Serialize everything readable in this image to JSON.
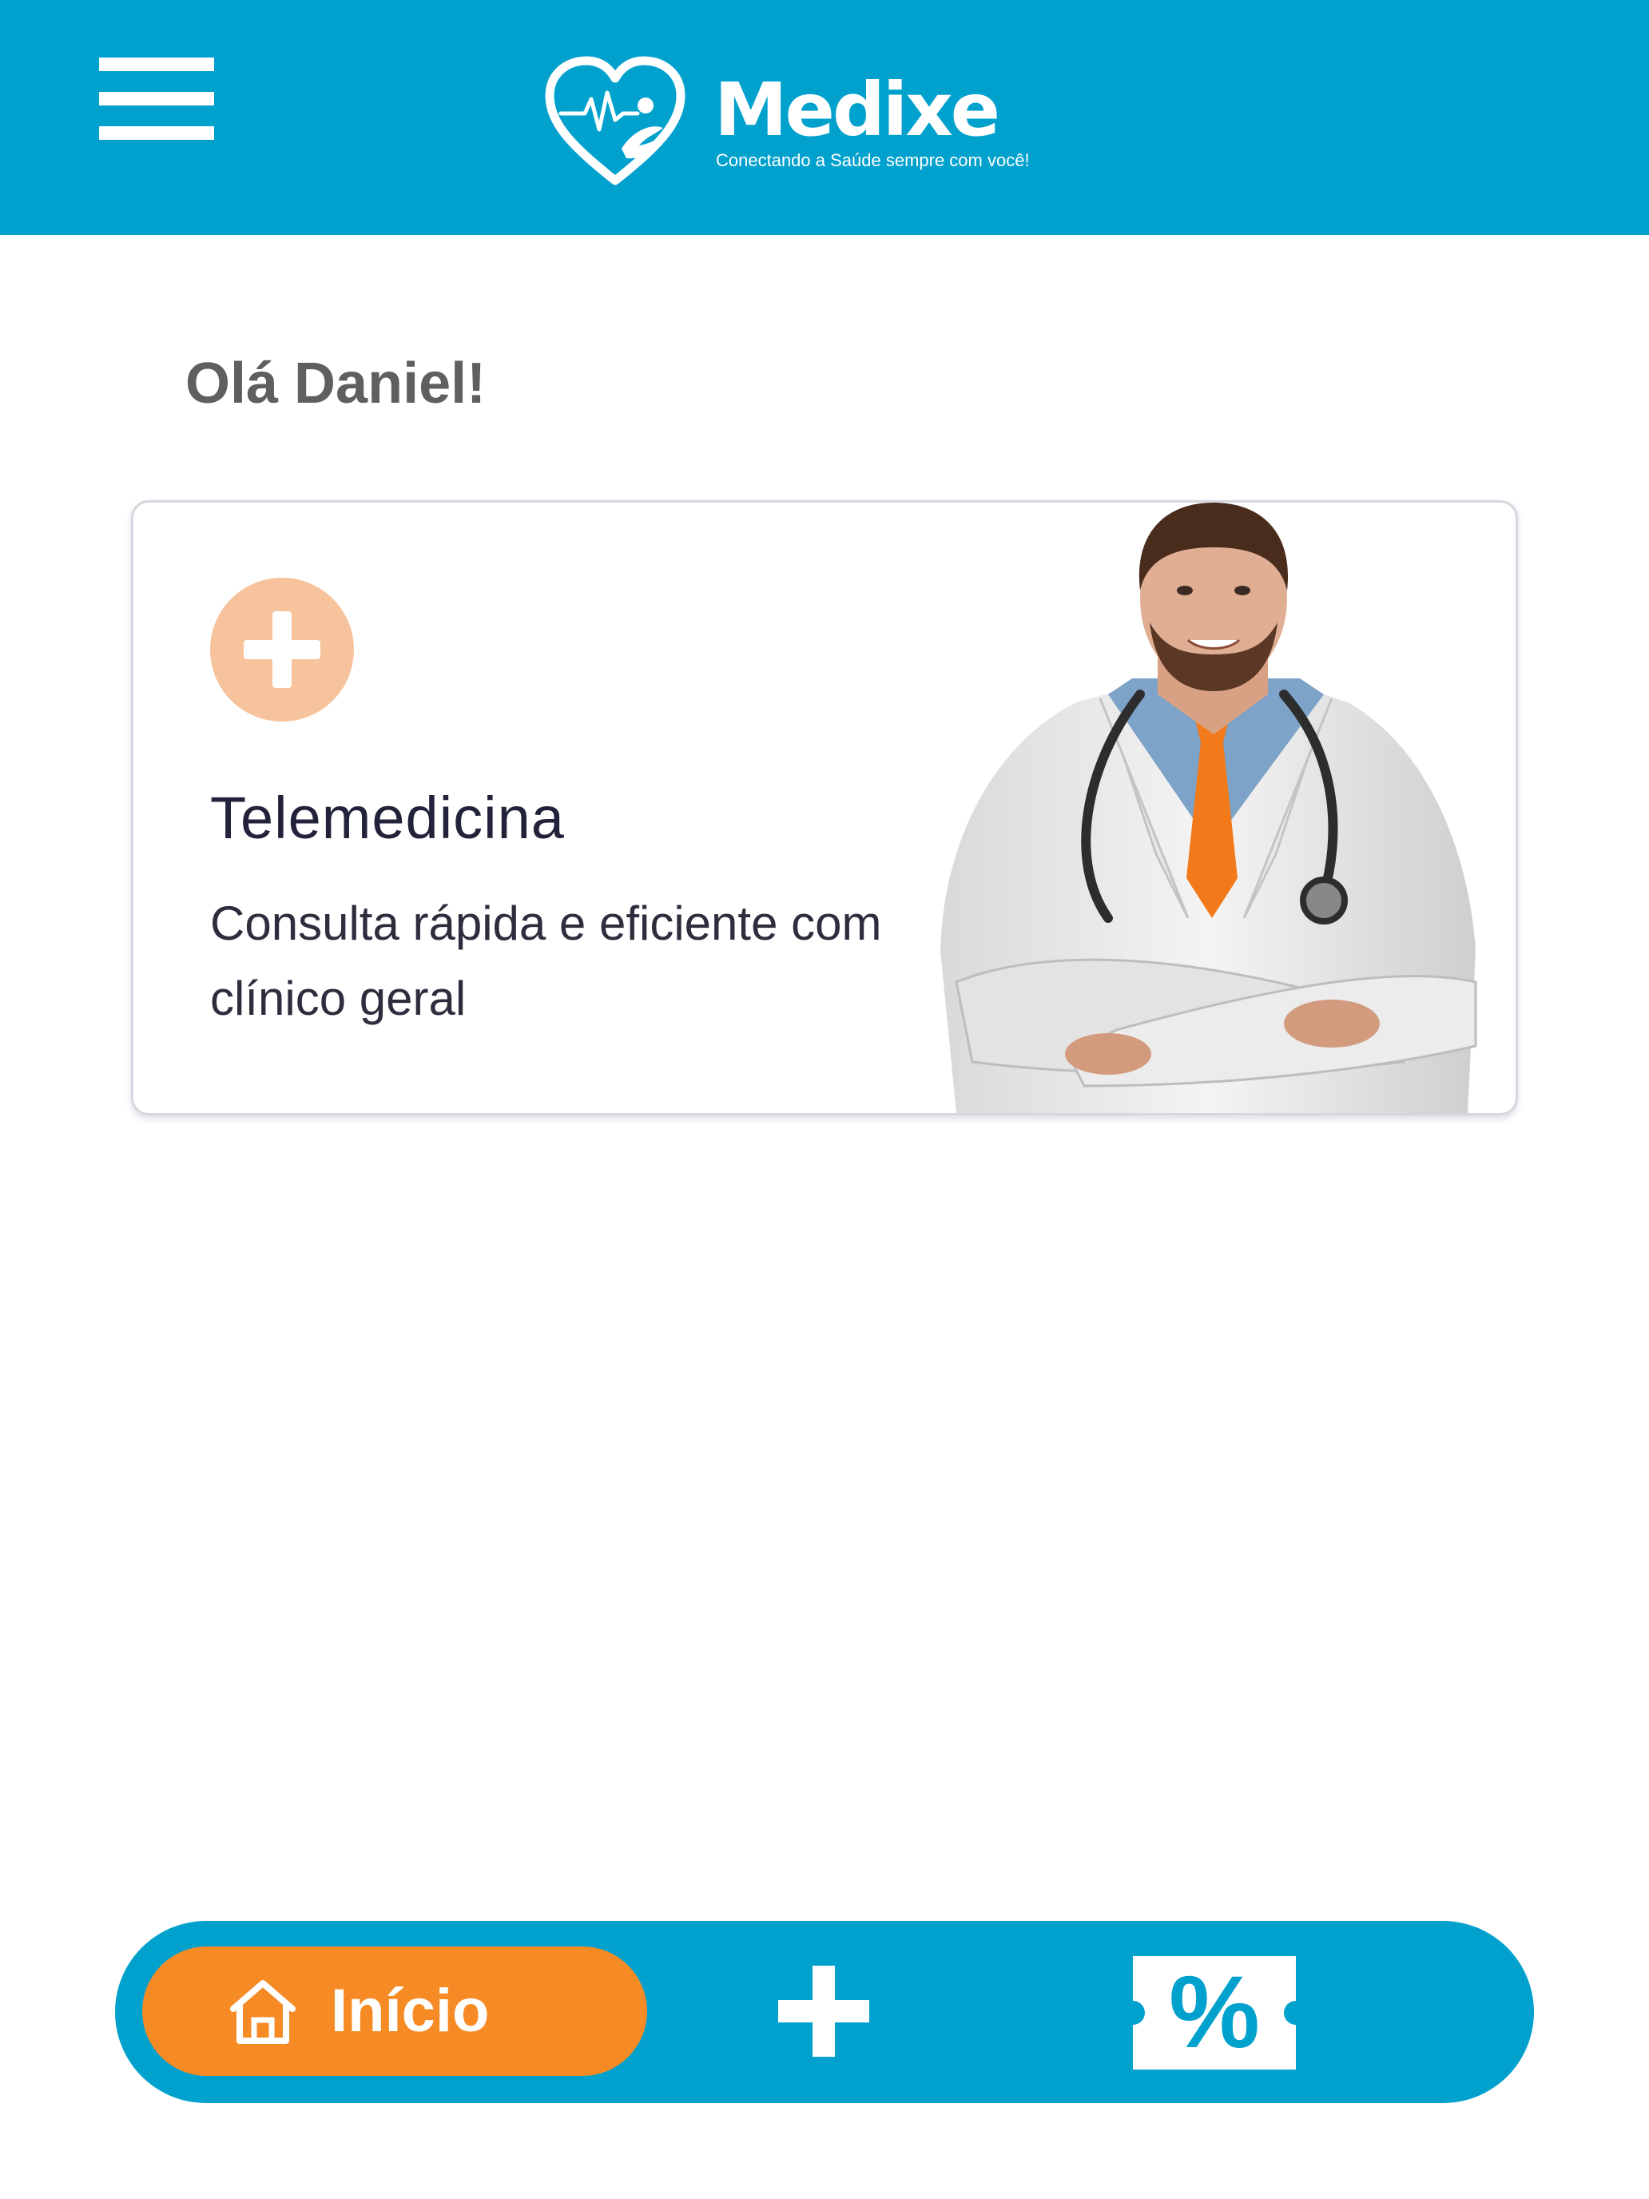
{
  "header": {
    "background": "#00a1cd",
    "menu_icon": "hamburger-menu-icon",
    "logo": {
      "name": "Medixe",
      "tagline": "Conectando a Saúde sempre com você!"
    }
  },
  "greeting": "Olá Daniel!",
  "service_card": {
    "icon": "plus-circle-icon",
    "icon_color": "#f6c39c",
    "title": "Telemedicina",
    "subtitle": "Consulta rápida e eficiente com clínico geral"
  },
  "bottom_nav": {
    "background": "#00a1cd",
    "active_color": "#f68b26",
    "items": [
      {
        "icon": "home-icon",
        "label": "Início",
        "active": true
      },
      {
        "icon": "plus-icon",
        "active": false
      },
      {
        "icon": "discount-ticket-icon",
        "symbol": "%",
        "active": false
      }
    ]
  }
}
